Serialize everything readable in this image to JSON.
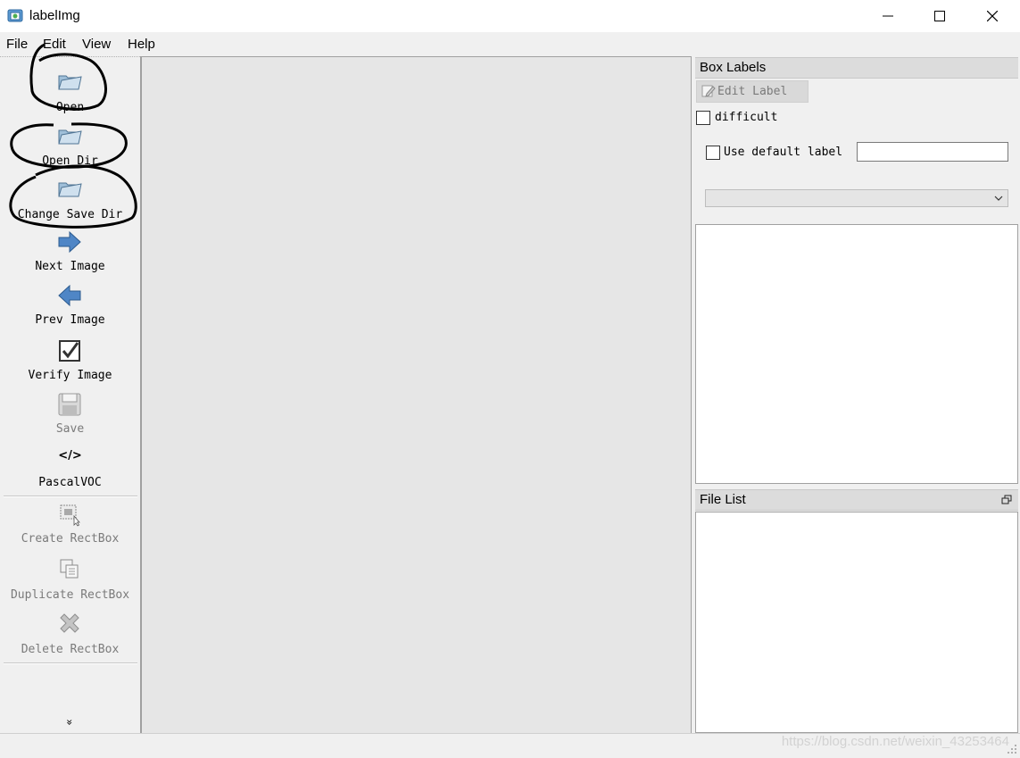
{
  "window": {
    "title": "labelImg"
  },
  "menu": {
    "file": "File",
    "edit": "Edit",
    "view": "View",
    "help": "Help"
  },
  "toolbar": {
    "open": "Open",
    "open_dir": "Open Dir",
    "change_save_dir": "Change Save Dir",
    "next_image": "Next Image",
    "prev_image": "Prev Image",
    "verify_image": "Verify Image",
    "save": "Save",
    "format_icon_text": "</>",
    "format": "PascalVOC",
    "create_rectbox": "Create RectBox",
    "duplicate_rectbox": "Duplicate RectBox",
    "delete_rectbox": "Delete RectBox",
    "more_glyph": "»"
  },
  "box_labels": {
    "title": "Box Labels",
    "edit_label": "Edit Label",
    "difficult": "difficult",
    "use_default_label": "Use default label",
    "default_label_value": ""
  },
  "file_list": {
    "title": "File List"
  },
  "watermark": "https://blog.csdn.net/weixin_43253464"
}
